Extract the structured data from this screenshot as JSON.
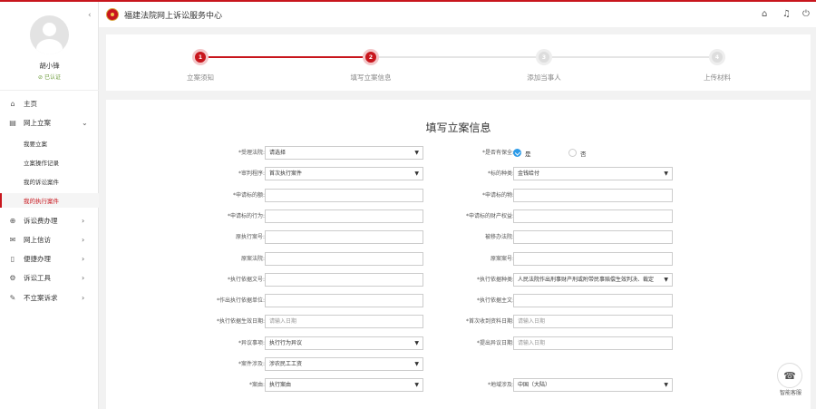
{
  "header": {
    "title": "福建法院网上诉讼服务中心",
    "icons": [
      "home-icon",
      "bell-icon",
      "power-icon"
    ]
  },
  "user": {
    "name": "胡小锋",
    "status": "已认证"
  },
  "nav": {
    "home": "主页",
    "online_filing": "网上立案",
    "sub_items": [
      "我要立案",
      "立案操作记录",
      "我的诉讼案件",
      "我的执行案件"
    ],
    "items": [
      "诉讼费办理",
      "网上信访",
      "便捷办理",
      "诉讼工具",
      "不立案诉求"
    ]
  },
  "steps": [
    {
      "num": "1",
      "label": "立案须知"
    },
    {
      "num": "2",
      "label": "填写立案信息"
    },
    {
      "num": "3",
      "label": "添加当事人"
    },
    {
      "num": "4",
      "label": "上传材料"
    }
  ],
  "form": {
    "title": "填写立案信息",
    "left": [
      {
        "label": "*受理法院:",
        "value": "请选择",
        "select": true
      },
      {
        "label": "*审判程序:",
        "value": "首次执行案件",
        "select": true
      },
      {
        "label": "*申请标的额:",
        "value": ""
      },
      {
        "label": "*申请标的行为:",
        "value": ""
      },
      {
        "label": "原执行案号:",
        "value": ""
      },
      {
        "label": "原案法院:",
        "value": ""
      },
      {
        "label": "*执行依据文号:",
        "value": ""
      },
      {
        "label": "*作出执行依据单位:",
        "value": ""
      },
      {
        "label": "*执行依据生效日期:",
        "value": "请输入日期",
        "placeholder": true
      },
      {
        "label": "*异议事项:",
        "value": "执行行为异议",
        "select": true
      },
      {
        "label": "*案件涉及:",
        "value": "涉农民工工资",
        "select": true
      },
      {
        "label": "*案由:",
        "value": "执行案由",
        "select": true
      }
    ],
    "right": [
      {
        "label": "*是否有保全:"
      },
      {
        "label": "*标的种类:",
        "value": "金钱给付",
        "select": true
      },
      {
        "label": "*申请标的物:",
        "value": ""
      },
      {
        "label": "*申请标的财产权益:",
        "value": ""
      },
      {
        "label": "被移办法院:",
        "value": ""
      },
      {
        "label": "原案案号:",
        "value": ""
      },
      {
        "label": "*执行依据种类:",
        "value": "人民法院作出刑事财产刑或附带民事赔偿生效判决、裁定",
        "select": true
      },
      {
        "label": "*执行依据主文:",
        "value": ""
      },
      {
        "label": "*首次收到资料日期:",
        "value": "请输入日期",
        "placeholder": true
      },
      {
        "label": "*提出异议日期:",
        "value": "请输入日期",
        "placeholder": true
      },
      null,
      {
        "label": "*地域涉及:",
        "value": "中国（大陆）",
        "select": true
      }
    ],
    "preservation_yes": "是",
    "preservation_no": "否"
  },
  "service": {
    "label": "智能客服"
  }
}
